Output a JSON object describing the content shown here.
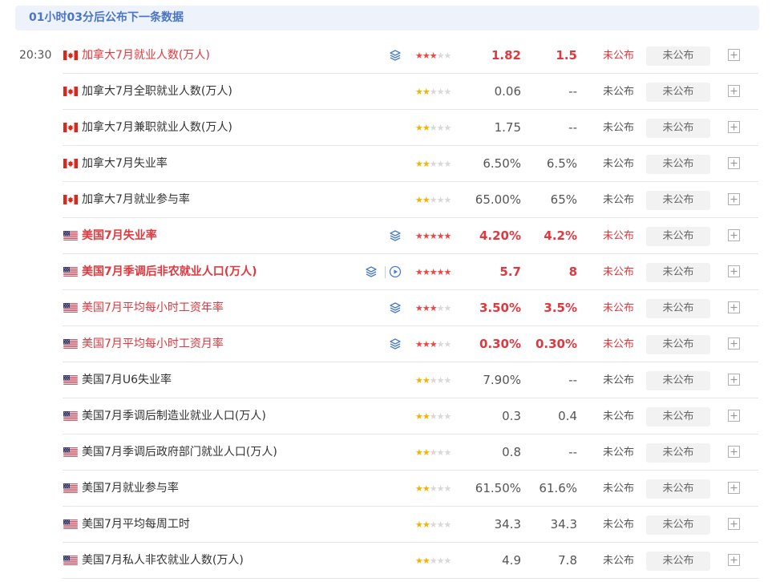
{
  "banner": {
    "text": "01小时03分后公布下一条数据"
  },
  "time": "20:30",
  "status_pill": "未公布",
  "colors": {
    "highlight": "#e0383e",
    "accent": "#4a74c6",
    "star_gold": "#f5b301",
    "star_red": "#ef4444"
  },
  "rows": [
    {
      "country": "CA",
      "name": "加拿大7月就业人数(万人)",
      "stars": 3,
      "prev": "1.82",
      "forecast": "1.5",
      "actual": "未公布",
      "highlight": true,
      "bold": false,
      "layers": true,
      "video": false
    },
    {
      "country": "CA",
      "name": "加拿大7月全职就业人数(万人)",
      "stars": 2,
      "prev": "0.06",
      "forecast": "--",
      "actual": "未公布",
      "highlight": false,
      "bold": false,
      "layers": false,
      "video": false
    },
    {
      "country": "CA",
      "name": "加拿大7月兼职就业人数(万人)",
      "stars": 2,
      "prev": "1.75",
      "forecast": "--",
      "actual": "未公布",
      "highlight": false,
      "bold": false,
      "layers": false,
      "video": false
    },
    {
      "country": "CA",
      "name": "加拿大7月失业率",
      "stars": 2,
      "prev": "6.50%",
      "forecast": "6.5%",
      "actual": "未公布",
      "highlight": false,
      "bold": false,
      "layers": false,
      "video": false
    },
    {
      "country": "CA",
      "name": "加拿大7月就业参与率",
      "stars": 2,
      "prev": "65.00%",
      "forecast": "65%",
      "actual": "未公布",
      "highlight": false,
      "bold": false,
      "layers": false,
      "video": false
    },
    {
      "country": "US",
      "name": "美国7月失业率",
      "stars": 5,
      "prev": "4.20%",
      "forecast": "4.2%",
      "actual": "未公布",
      "highlight": true,
      "bold": true,
      "layers": true,
      "video": false
    },
    {
      "country": "US",
      "name": "美国7月季调后非农就业人口(万人)",
      "stars": 5,
      "prev": "5.7",
      "forecast": "8",
      "actual": "未公布",
      "highlight": true,
      "bold": true,
      "layers": true,
      "video": true
    },
    {
      "country": "US",
      "name": "美国7月平均每小时工资年率",
      "stars": 3,
      "prev": "3.50%",
      "forecast": "3.5%",
      "actual": "未公布",
      "highlight": true,
      "bold": false,
      "layers": true,
      "video": false
    },
    {
      "country": "US",
      "name": "美国7月平均每小时工资月率",
      "stars": 3,
      "prev": "0.30%",
      "forecast": "0.30%",
      "actual": "未公布",
      "highlight": true,
      "bold": false,
      "layers": true,
      "video": false
    },
    {
      "country": "US",
      "name": "美国7月U6失业率",
      "stars": 2,
      "prev": "7.90%",
      "forecast": "--",
      "actual": "未公布",
      "highlight": false,
      "bold": false,
      "layers": false,
      "video": false
    },
    {
      "country": "US",
      "name": "美国7月季调后制造业就业人口(万人)",
      "stars": 2,
      "prev": "0.3",
      "forecast": "0.4",
      "actual": "未公布",
      "highlight": false,
      "bold": false,
      "layers": false,
      "video": false
    },
    {
      "country": "US",
      "name": "美国7月季调后政府部门就业人口(万人)",
      "stars": 2,
      "prev": "0.8",
      "forecast": "--",
      "actual": "未公布",
      "highlight": false,
      "bold": false,
      "layers": false,
      "video": false
    },
    {
      "country": "US",
      "name": "美国7月就业参与率",
      "stars": 2,
      "prev": "61.50%",
      "forecast": "61.6%",
      "actual": "未公布",
      "highlight": false,
      "bold": false,
      "layers": false,
      "video": false
    },
    {
      "country": "US",
      "name": "美国7月平均每周工时",
      "stars": 2,
      "prev": "34.3",
      "forecast": "34.3",
      "actual": "未公布",
      "highlight": false,
      "bold": false,
      "layers": false,
      "video": false
    },
    {
      "country": "US",
      "name": "美国7月私人非农就业人数(万人)",
      "stars": 2,
      "prev": "4.9",
      "forecast": "7.8",
      "actual": "未公布",
      "highlight": false,
      "bold": false,
      "layers": false,
      "video": false
    }
  ]
}
